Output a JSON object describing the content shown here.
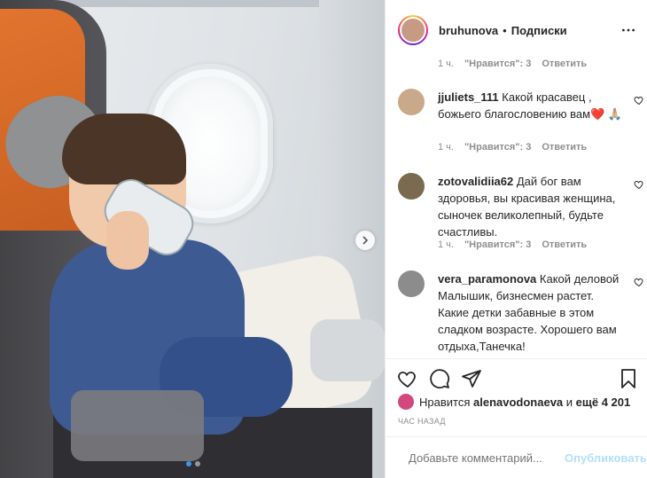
{
  "header": {
    "username": "bruhunova",
    "separator": "•",
    "follow_label": "Подписки"
  },
  "comments": {
    "first_meta": {
      "time": "1 ч.",
      "likes": "\"Нравится\": 3",
      "reply": "Ответить"
    },
    "items": [
      {
        "user": "jjuliets_111",
        "text": "Какой красавец , божьего благословению вам❤️ 🙏🏼",
        "time": "1 ч.",
        "likes": "\"Нравится\": 3",
        "reply": "Ответить",
        "avatar_color": "#c9a98a"
      },
      {
        "user": "zotovalidiia62",
        "text": "Дай бог вам здоровья, вы красивая женщина, сыночек великолепный, будьте счастливы.",
        "time": "1 ч.",
        "likes": "\"Нравится\": 3",
        "reply": "Ответить",
        "avatar_color": "#7a6a4f"
      },
      {
        "user": "vera_paramonova",
        "text": "Какой деловой Малышик, бизнесмен растет. Какие детки забавные в этом сладком возрасте. Хорошего вам отдыха,Танечка!",
        "avatar_color": "#8c8c8c"
      }
    ]
  },
  "likes": {
    "prefix": "Нравится",
    "user": "alenavodonaeva",
    "middle": "и",
    "rest": "ещё 4 201"
  },
  "time_ago": "ЧАС НАЗАД",
  "add_comment": {
    "placeholder": "Добавьте комментарий...",
    "publish_label": "Опубликовать"
  },
  "colors": {
    "accent": "#3897f0",
    "publish_disabled": "#b2dffc",
    "muted": "#8e8e8e",
    "text": "#262626",
    "like_heart": "#ed4956"
  },
  "carousel": {
    "total": 2,
    "current": 1
  }
}
